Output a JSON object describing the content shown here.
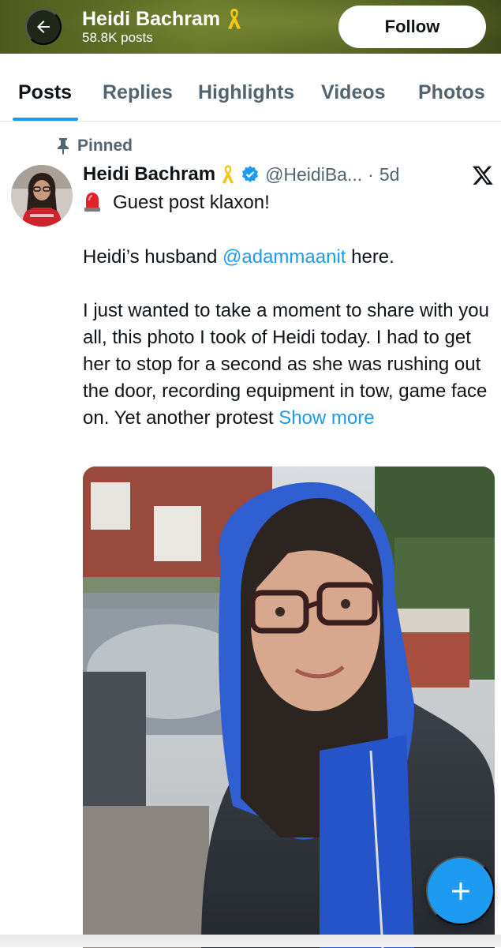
{
  "header": {
    "name": "Heidi Bachram",
    "posts_count": "58.8K posts",
    "follow_label": "Follow",
    "back_icon": "arrow-left-icon",
    "ribbon_icon": "yellow-ribbon-icon",
    "background_color": "#5b6a27"
  },
  "tabs": [
    {
      "label": "Posts",
      "active": true
    },
    {
      "label": "Replies",
      "active": false
    },
    {
      "label": "Highlights",
      "active": false
    },
    {
      "label": "Videos",
      "active": false
    },
    {
      "label": "Photos",
      "active": false
    }
  ],
  "post": {
    "pinned_label": "Pinned",
    "author_name": "Heidi Bachram",
    "handle": "@HeidiBa...",
    "separator": "·",
    "time": "5d",
    "verified_icon": "verified-badge-icon",
    "platform_icon": "x-logo-icon",
    "line1_emoji": "police-light-icon",
    "line1": "Guest post klaxon!",
    "para2_prefix": "Heidi’s husband ",
    "para2_mention": "@adammaanit",
    "para2_suffix": " here.",
    "para3": "I just wanted to take a moment to share with you all, this photo I took of Heidi today. I had to get her to stop for a second as she was rushing out the door, recording equipment in tow, game face on. Yet another protest ",
    "show_more": "Show more"
  },
  "colors": {
    "accent": "#1d9bf0",
    "text_primary": "#0f1419",
    "text_secondary": "#536471",
    "ribbon": "#f5c518"
  },
  "fab_icon": "plus-icon"
}
